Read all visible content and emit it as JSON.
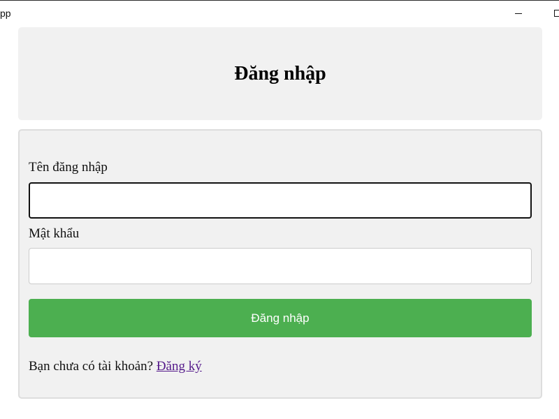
{
  "window": {
    "title": "pp",
    "controls": {
      "minimize_icon": "minimize-icon",
      "maximize_icon": "maximize-icon"
    }
  },
  "header": {
    "title": "Đăng nhập"
  },
  "form": {
    "username_label": "Tên đăng nhập",
    "username_value": "",
    "password_label": "Mật khẩu",
    "password_value": "",
    "submit_label": "Đăng nhập",
    "signup_prompt": "Bạn chưa có tài khoản?",
    "signup_link": "Đăng ký"
  },
  "colors": {
    "panel_background": "#f1f1f1",
    "button_background": "#4caf50",
    "button_text": "#ffffff",
    "link": "#551a8b"
  }
}
